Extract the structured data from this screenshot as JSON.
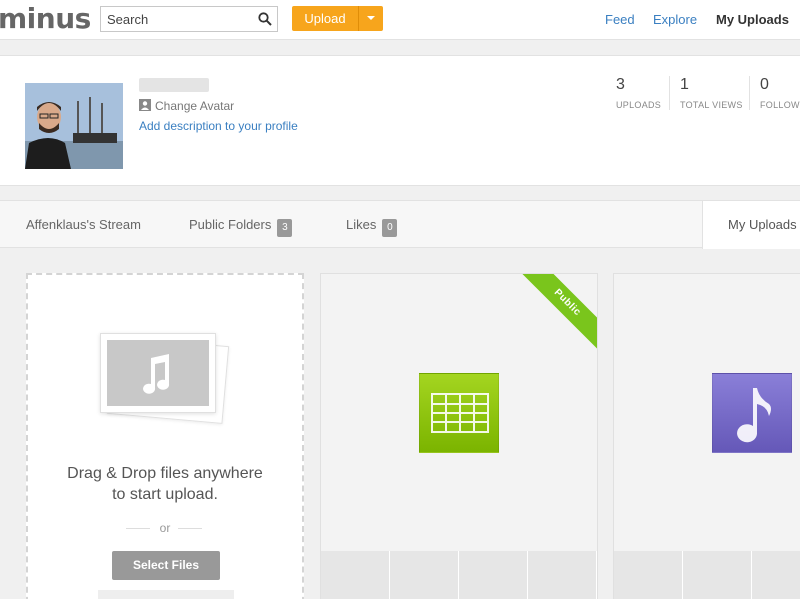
{
  "header": {
    "logo": "minus",
    "search_placeholder": "Search",
    "upload_label": "Upload",
    "nav": {
      "feed": "Feed",
      "explore": "Explore",
      "my_uploads": "My Uploads"
    }
  },
  "profile": {
    "change_avatar": "Change Avatar",
    "add_description": "Add description to your profile",
    "stats": [
      {
        "value": "3",
        "label": "UPLOADS"
      },
      {
        "value": "1",
        "label": "TOTAL VIEWS"
      },
      {
        "value": "0",
        "label": "FOLLOWE"
      }
    ]
  },
  "tabs": {
    "stream": "Affenklaus's Stream",
    "public_folders": "Public Folders",
    "public_folders_count": "3",
    "likes": "Likes",
    "likes_count": "0",
    "my_uploads": "My Uploads"
  },
  "dropzone": {
    "line1": "Drag & Drop files anywhere",
    "line2": "to start upload.",
    "or": "or",
    "select_files": "Select Files"
  },
  "cards": [
    {
      "type": "spreadsheet",
      "ribbon": "Public",
      "icon_color": "#8cc414"
    },
    {
      "type": "music",
      "icon_color": "#7568c8"
    }
  ],
  "colors": {
    "accent_orange": "#f7a51c",
    "link_blue": "#3a7fc1",
    "ribbon_green": "#7ac51c"
  }
}
